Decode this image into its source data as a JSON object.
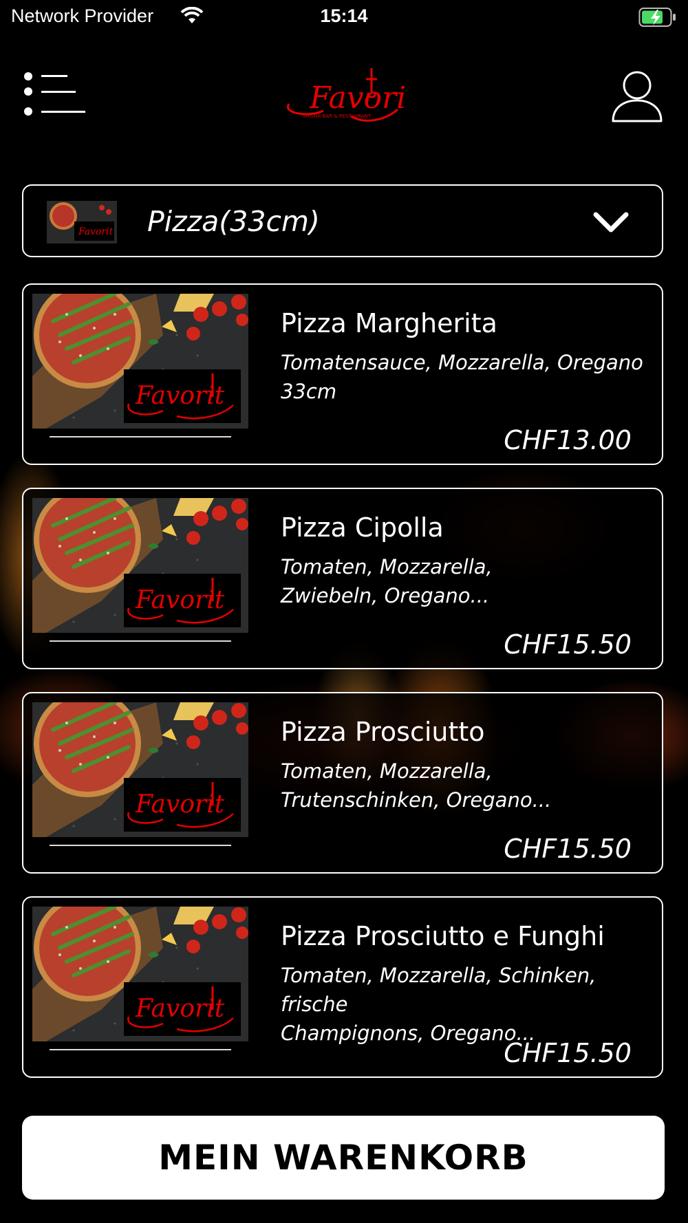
{
  "status_bar": {
    "carrier": "Network Provider",
    "time": "15:14"
  },
  "header": {
    "logo_text": "Favorit",
    "logo_subtitle": "SHISHA BAR & RESTAURANT"
  },
  "category": {
    "label": "Pizza(33cm)"
  },
  "products": [
    {
      "name": "Pizza Margherita",
      "desc_line1": "Tomatensauce, Mozzarella, Oregano",
      "desc_line2": "33cm",
      "price": "CHF13.00"
    },
    {
      "name": "Pizza Cipolla",
      "desc_line1": "Tomaten, Mozzarella,",
      "desc_line2": "Zwiebeln, Oregano...",
      "price": "CHF15.50"
    },
    {
      "name": "Pizza Prosciutto",
      "desc_line1": "Tomaten, Mozzarella,",
      "desc_line2": "Trutenschinken, Oregano...",
      "price": "CHF15.50"
    },
    {
      "name": "Pizza Prosciutto e Funghi",
      "desc_line1": "Tomaten, Mozzarella, Schinken, frische",
      "desc_line2": "Champignons, Oregano...",
      "price": "CHF15.50"
    }
  ],
  "cart": {
    "label": "MEIN WARENKORB"
  },
  "colors": {
    "background": "#000000",
    "brand_red": "#e60000",
    "battery_green": "#4cd964"
  }
}
